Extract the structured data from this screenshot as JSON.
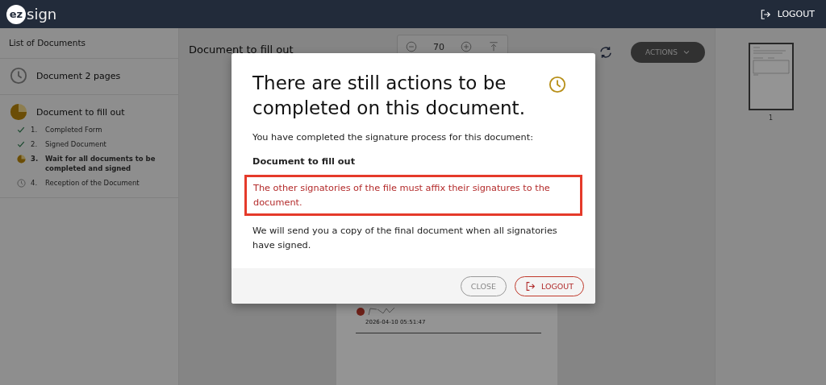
{
  "header": {
    "brand": {
      "badge": "ez",
      "name": "sign"
    },
    "logout": "LOGOUT"
  },
  "sidebar": {
    "title": "List of Documents",
    "documents": [
      {
        "name": "Document 2 pages",
        "kind": "pending"
      },
      {
        "name": "Document to fill out",
        "kind": "in_progress",
        "steps": [
          {
            "number": "1.",
            "label": "Completed Form",
            "kind": "done"
          },
          {
            "number": "2.",
            "label": "Signed Document",
            "kind": "done"
          },
          {
            "number": "3.",
            "label": "Wait for all documents to be completed and signed",
            "kind": "in_progress"
          },
          {
            "number": "4.",
            "label": "Reception of the Document",
            "kind": "pending"
          }
        ]
      }
    ]
  },
  "document": {
    "title": "Document to fill out",
    "zoom": "70",
    "actions": "ACTIONS",
    "signature_date": "2026-04-10 05:51:47"
  },
  "thumbnails": [
    {
      "label": "1",
      "selected": true
    }
  ],
  "modal": {
    "title": "There are still actions to be completed on this document.",
    "intro": "You have completed the signature process for this document:",
    "document_name": "Document to fill out",
    "warning": "The other signatories of the file must affix their signatures to the document.",
    "note": "We will send you a copy of the final document when all signatories have signed.",
    "buttons": [
      {
        "label": "CLOSE",
        "kind": "secondary"
      },
      {
        "label": "LOGOUT",
        "kind": "logout"
      }
    ]
  }
}
